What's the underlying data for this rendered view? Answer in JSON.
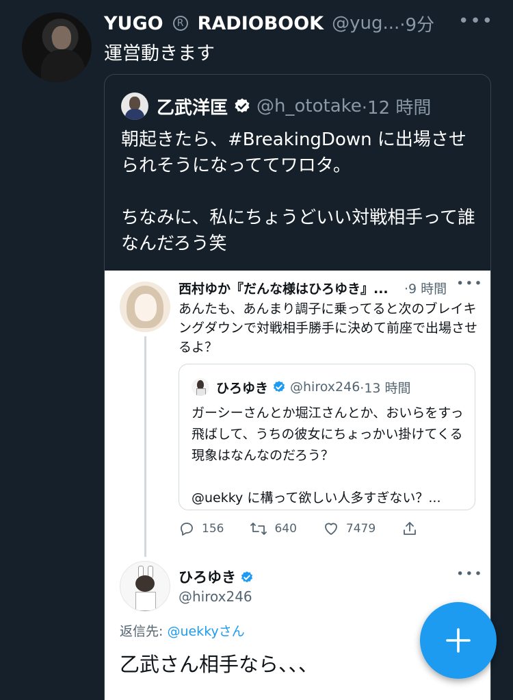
{
  "tweet": {
    "name_part1": "YUGO",
    "name_part2": "RADIOBOOK",
    "handle": "@yug...",
    "time": "·9分",
    "text": "運営動きます",
    "more": "•••"
  },
  "quote": {
    "name": "乙武洋匡",
    "handle": "@h_ototake",
    "time": "·12 時間",
    "text": "朝起きたら、#BreakingDown に出場させられそうになっててワロタ。\n\nちなみに、私にちょうどいい対戦相手って誰なんだろう笑"
  },
  "screenshot": {
    "reply": {
      "name": "西村ゆか『だんな様はひろゆき』...",
      "time": "·9 時間",
      "more": "•••",
      "text": "あんたも、あんまり調子に乗ってると次のブレイキングダウンで対戦相手勝手に決めて前座で出場させるよ？"
    },
    "inner_quote": {
      "name": "ひろゆき",
      "handle": "@hirox246",
      "time": "·13 時間",
      "text": "ガーシーさんとか堀江さんとか、おいらをすっ飛ばして、うちの彼女にちょっかい掛けてくる現象はなんなのだろう？\n\n@uekky に構って欲しい人多すぎない？..."
    },
    "actions": {
      "replies": "156",
      "retweets": "640",
      "likes": "7479"
    },
    "hiroyuki": {
      "name": "ひろゆき",
      "handle": "@hirox246",
      "more": "•••",
      "reply_to_prefix": "返信先: ",
      "reply_to_mention": "@uekky",
      "reply_to_suffix": "さん",
      "text": "乙武さん相手なら、、、"
    }
  },
  "colors": {
    "background": "#15202b",
    "accent": "#1d9bf0",
    "secondary_text": "#8b98a5"
  },
  "icons": [
    "registered-icon",
    "verified-icon",
    "reply-icon",
    "retweet-icon",
    "like-icon",
    "share-icon",
    "compose-plus-icon"
  ]
}
